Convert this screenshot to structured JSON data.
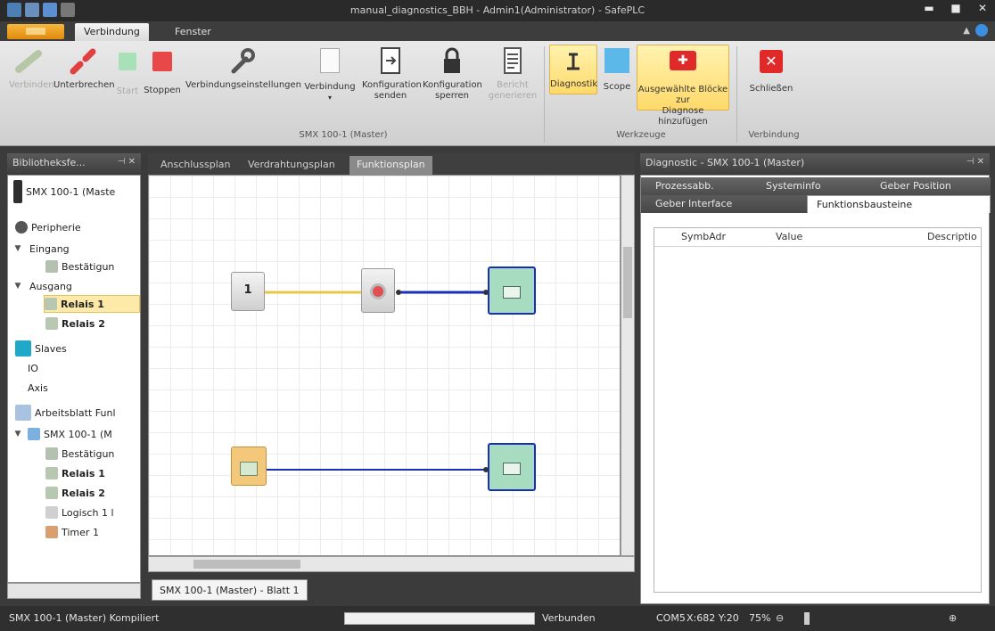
{
  "window": {
    "title": "manual_diagnostics_BBH - Admin1(Administrator) - SafePLC"
  },
  "tabs": [
    "Verbindung",
    "Fenster"
  ],
  "ribbon": {
    "buttons": {
      "verbinden": "Verbinden",
      "unterbrechen": "Unterbrechen",
      "start": "Start",
      "stoppen": "Stoppen",
      "verbindungseinstellungen": "Verbindungseinstellungen",
      "verbindung": "Verbindung",
      "konfig_senden": [
        "Konfiguration",
        "senden"
      ],
      "konfig_sperren": [
        "Konfiguration",
        "sperren"
      ],
      "bericht": [
        "Bericht",
        "generieren"
      ],
      "diagnostik": "Diagnostik",
      "scope": "Scope",
      "ausgewaehlte": [
        "Ausgewählte Blöcke  zur",
        "Diagnose hinzufügen"
      ],
      "schliessen": "Schließen"
    },
    "groups": {
      "main": "SMX 100-1 (Master)",
      "werkzeuge": "Werkzeuge",
      "verbindung": "Verbindung"
    }
  },
  "library": {
    "title": "Bibliotheksfe...",
    "items": [
      "SMX 100-1 (Maste",
      "Peripherie",
      "Eingang",
      "Bestätigun",
      "Ausgang",
      "Relais 1",
      "Relais 2",
      "Slaves",
      "IO",
      "Axis",
      "Arbeitsblatt Funl",
      "SMX 100-1 (M",
      "Bestätigun",
      "Relais 1",
      "Relais 2",
      "Logisch 1 l",
      "Timer 1"
    ]
  },
  "doc_tabs": [
    "Anschlussplan",
    "Verdrahtungsplan",
    "Funktionsplan"
  ],
  "canvas": {
    "blocks": {
      "logic": "1"
    },
    "sheet_tab": "SMX 100-1 (Master) - Blatt 1"
  },
  "diag": {
    "title": "Diagnostic - SMX 100-1 (Master)",
    "tabs_row1": [
      "Prozessabb.",
      "Systeminfo",
      "Geber Position"
    ],
    "tabs_row2": [
      "Geber Interface",
      "Funktionsbausteine"
    ],
    "columns": [
      "SymbAdr",
      "Value",
      "Descriptio"
    ]
  },
  "status": {
    "left": "SMX 100-1 (Master)  Kompiliert",
    "connection": "Verbunden",
    "port": "COM5",
    "coords": "X:682 Y:20",
    "zoom": "75%"
  },
  "colors": {
    "accent": "#e08a0e",
    "selected": "#fde9a8",
    "link_yellow": "#e8c84a",
    "link_blue": "#1a2fb8"
  }
}
